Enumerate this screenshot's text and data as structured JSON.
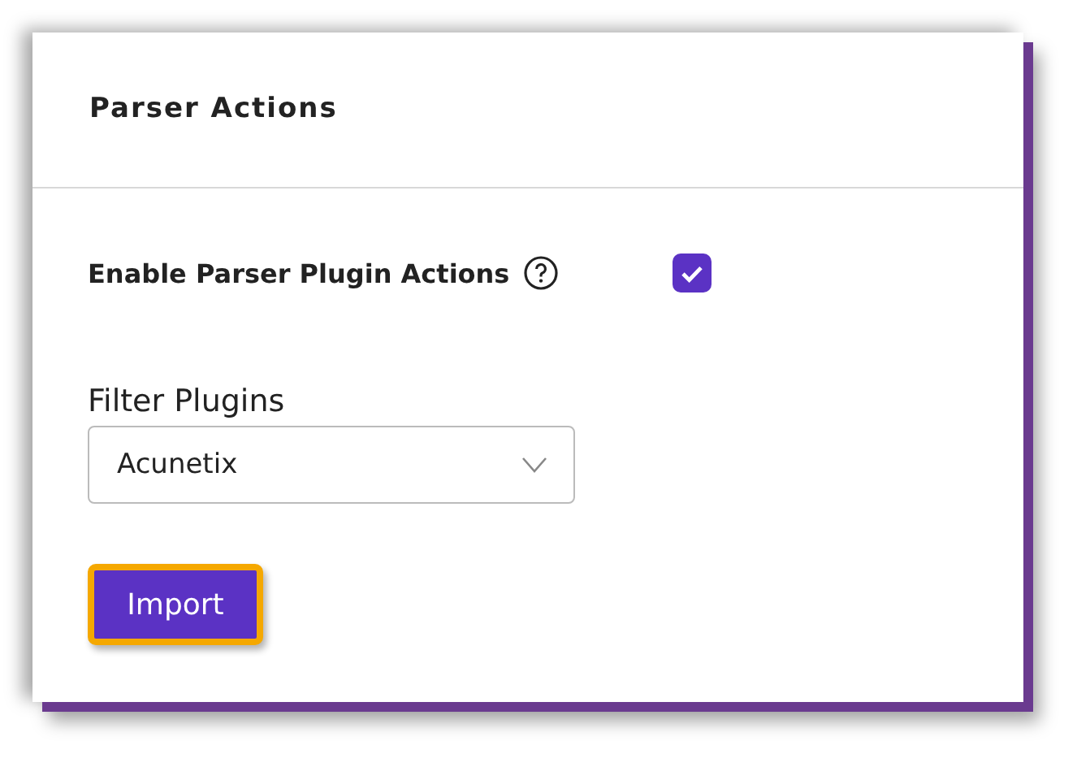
{
  "panel": {
    "title": "Parser Actions"
  },
  "enable_setting": {
    "label": "Enable Parser Plugin Actions",
    "checked": true
  },
  "filter": {
    "label": "Filter Plugins",
    "value": "Acunetix"
  },
  "import_button": {
    "label": "Import",
    "highlighted": true
  }
}
